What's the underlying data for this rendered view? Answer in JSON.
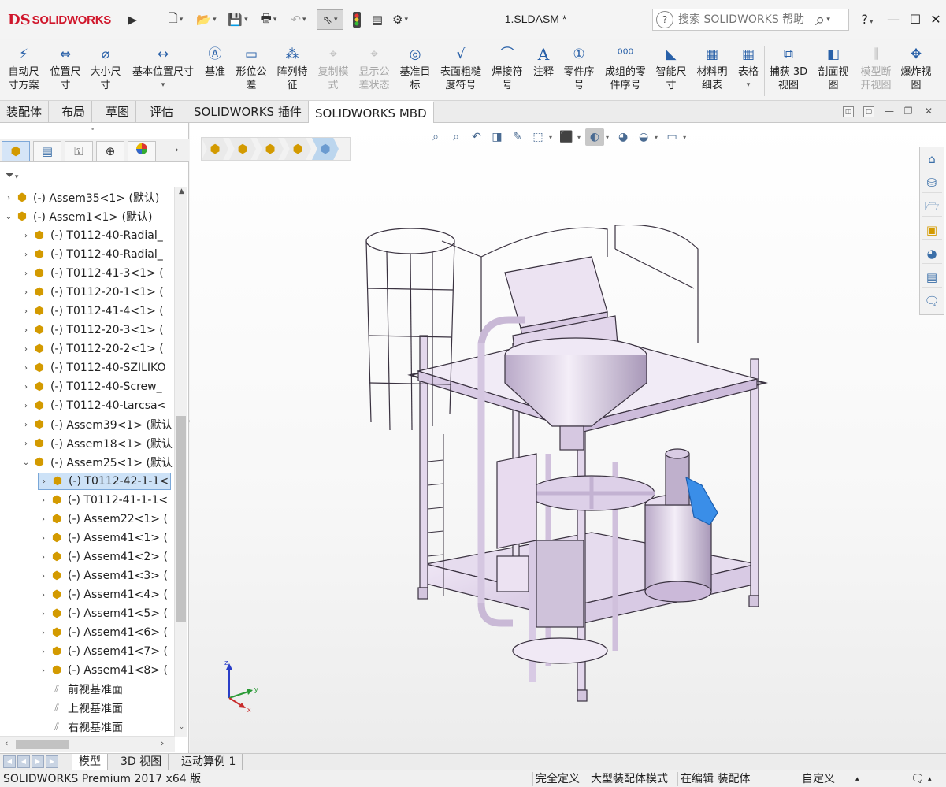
{
  "app": {
    "brand_ds": "DS",
    "brand_name": "SOLIDWORKS",
    "document_title": "1.SLDASM *"
  },
  "search": {
    "placeholder": "搜索 SOLIDWORKS 帮助"
  },
  "window_controls": {
    "help": "?",
    "minimize": "—",
    "maximize": "☐",
    "close": "✕"
  },
  "ribbon": [
    {
      "id": "auto-dim",
      "label": "自动尺\n寸方案",
      "icon": "auto-dimension-icon",
      "enabled": true
    },
    {
      "id": "location-dim",
      "label": "位置尺\n寸",
      "icon": "location-dimension-icon",
      "enabled": true
    },
    {
      "id": "size-dim",
      "label": "大小尺\n寸",
      "icon": "size-dimension-icon",
      "enabled": true
    },
    {
      "id": "basic-location-dim",
      "label": "基本位置尺寸",
      "icon": "basic-location-dimension-icon",
      "enabled": true
    },
    {
      "id": "datum",
      "label": "基准",
      "icon": "datum-icon",
      "enabled": true
    },
    {
      "id": "gtol",
      "label": "形位公\n差",
      "icon": "geometric-tolerance-icon",
      "enabled": true
    },
    {
      "id": "pattern-feature",
      "label": "阵列特\n征",
      "icon": "pattern-feature-icon",
      "enabled": true
    },
    {
      "id": "copy-scheme",
      "label": "复制模\n式",
      "icon": "copy-scheme-icon",
      "enabled": false
    },
    {
      "id": "show-tolerance",
      "label": "显示公\n差状态",
      "icon": "show-tolerance-status-icon",
      "enabled": false
    },
    {
      "id": "datum-target",
      "label": "基准目\n标",
      "icon": "datum-target-icon",
      "enabled": true
    },
    {
      "id": "surface-finish",
      "label": "表面粗糙\n度符号",
      "icon": "surface-finish-icon",
      "enabled": true
    },
    {
      "id": "weld-symbol",
      "label": "焊接符\n号",
      "icon": "weld-symbol-icon",
      "enabled": true
    },
    {
      "id": "note",
      "label": "注释",
      "icon": "note-icon",
      "enabled": true
    },
    {
      "id": "balloon",
      "label": "零件序\n号",
      "icon": "balloon-icon",
      "enabled": true
    },
    {
      "id": "stacked-balloon",
      "label": "成组的零\n件序号",
      "icon": "stacked-balloon-icon",
      "enabled": true
    },
    {
      "id": "smart-dim",
      "label": "智能尺\n寸",
      "icon": "smart-dimension-icon",
      "enabled": true
    },
    {
      "id": "bom",
      "label": "材料明\n细表",
      "icon": "bill-of-materials-icon",
      "enabled": true
    },
    {
      "id": "table",
      "label": "表格",
      "icon": "table-icon",
      "enabled": true
    },
    {
      "id": "capture-3d",
      "label": "捕获 3D\n视图",
      "icon": "capture-3d-view-icon",
      "enabled": true
    },
    {
      "id": "section-view",
      "label": "剖面视\n图",
      "icon": "section-view-icon",
      "enabled": true
    },
    {
      "id": "model-break",
      "label": "模型断\n开视图",
      "icon": "model-break-view-icon",
      "enabled": false
    },
    {
      "id": "exploded-view",
      "label": "爆炸视\n图",
      "icon": "exploded-view-icon",
      "enabled": true
    }
  ],
  "command_tabs": [
    {
      "label": "装配体",
      "active": false
    },
    {
      "label": "布局",
      "active": false
    },
    {
      "label": "草图",
      "active": false
    },
    {
      "label": "评估",
      "active": false
    },
    {
      "label": "SOLIDWORKS 插件",
      "active": false
    },
    {
      "label": "SOLIDWORKS MBD",
      "active": true
    }
  ],
  "tree": [
    {
      "label": "(-) Assem35<1> (默认)",
      "level": 0,
      "expander": "›",
      "icon": "assembly-icon"
    },
    {
      "label": "(-) Assem1<1> (默认)",
      "level": 0,
      "expander": "⌄",
      "icon": "assembly-icon"
    },
    {
      "label": "(-) T0112-40-Radial_",
      "level": 1,
      "expander": "›",
      "icon": "assembly-icon"
    },
    {
      "label": "(-) T0112-40-Radial_",
      "level": 1,
      "expander": "›",
      "icon": "assembly-icon"
    },
    {
      "label": "(-) T0112-41-3<1> (",
      "level": 1,
      "expander": "›",
      "icon": "assembly-icon"
    },
    {
      "label": "(-) T0112-20-1<1> (",
      "level": 1,
      "expander": "›",
      "icon": "assembly-icon"
    },
    {
      "label": "(-) T0112-41-4<1> (",
      "level": 1,
      "expander": "›",
      "icon": "assembly-icon"
    },
    {
      "label": "(-) T0112-20-3<1> (",
      "level": 1,
      "expander": "›",
      "icon": "assembly-icon"
    },
    {
      "label": "(-) T0112-20-2<1> (",
      "level": 1,
      "expander": "›",
      "icon": "assembly-icon"
    },
    {
      "label": "(-) T0112-40-SZILIKO",
      "level": 1,
      "expander": "›",
      "icon": "assembly-icon"
    },
    {
      "label": "(-) T0112-40-Screw_",
      "level": 1,
      "expander": "›",
      "icon": "assembly-icon"
    },
    {
      "label": "(-) T0112-40-tarcsa<",
      "level": 1,
      "expander": "›",
      "icon": "assembly-icon"
    },
    {
      "label": "(-) Assem39<1> (默认",
      "level": 1,
      "expander": "›",
      "icon": "assembly-icon"
    },
    {
      "label": "(-) Assem18<1> (默认",
      "level": 1,
      "expander": "›",
      "icon": "assembly-icon"
    },
    {
      "label": "(-) Assem25<1> (默认",
      "level": 1,
      "expander": "⌄",
      "icon": "assembly-icon"
    },
    {
      "label": "(-) T0112-42-1-1<",
      "level": 2,
      "expander": "›",
      "icon": "assembly-icon",
      "selected": true
    },
    {
      "label": "(-) T0112-41-1-1<",
      "level": 2,
      "expander": "›",
      "icon": "assembly-icon"
    },
    {
      "label": "(-) Assem22<1> (",
      "level": 2,
      "expander": "›",
      "icon": "assembly-icon"
    },
    {
      "label": "(-) Assem41<1> (",
      "level": 2,
      "expander": "›",
      "icon": "assembly-icon"
    },
    {
      "label": "(-) Assem41<2> (",
      "level": 2,
      "expander": "›",
      "icon": "assembly-icon"
    },
    {
      "label": "(-) Assem41<3> (",
      "level": 2,
      "expander": "›",
      "icon": "assembly-icon"
    },
    {
      "label": "(-) Assem41<4> (",
      "level": 2,
      "expander": "›",
      "icon": "assembly-icon"
    },
    {
      "label": "(-) Assem41<5> (",
      "level": 2,
      "expander": "›",
      "icon": "assembly-icon"
    },
    {
      "label": "(-) Assem41<6> (",
      "level": 2,
      "expander": "›",
      "icon": "assembly-icon"
    },
    {
      "label": "(-) Assem41<7> (",
      "level": 2,
      "expander": "›",
      "icon": "assembly-icon"
    },
    {
      "label": "(-) Assem41<8> (",
      "level": 2,
      "expander": "›",
      "icon": "assembly-icon"
    },
    {
      "label": "前视基准面",
      "level": 2,
      "expander": "",
      "icon": "plane-icon"
    },
    {
      "label": "上视基准面",
      "level": 2,
      "expander": "",
      "icon": "plane-icon"
    },
    {
      "label": "右视基准面",
      "level": 2,
      "expander": "",
      "icon": "plane-icon"
    }
  ],
  "triad": {
    "x": "x",
    "y": "y",
    "z": "z"
  },
  "bottom_tabs": [
    {
      "label": "模型",
      "active": true
    },
    {
      "label": "3D 视图",
      "active": false
    },
    {
      "label": "运动算例 1",
      "active": false
    }
  ],
  "status": {
    "product": "SOLIDWORKS Premium 2017 x64 版",
    "definition": "完全定义",
    "mode": "大型装配体模式",
    "editing": "在编辑 装配体",
    "units": "自定义"
  },
  "colors": {
    "brand_red": "#d0162b",
    "selection_blue": "#cde2f7",
    "model_lilac": "#ddd0e8",
    "highlight_blue": "#3a8ee8"
  }
}
